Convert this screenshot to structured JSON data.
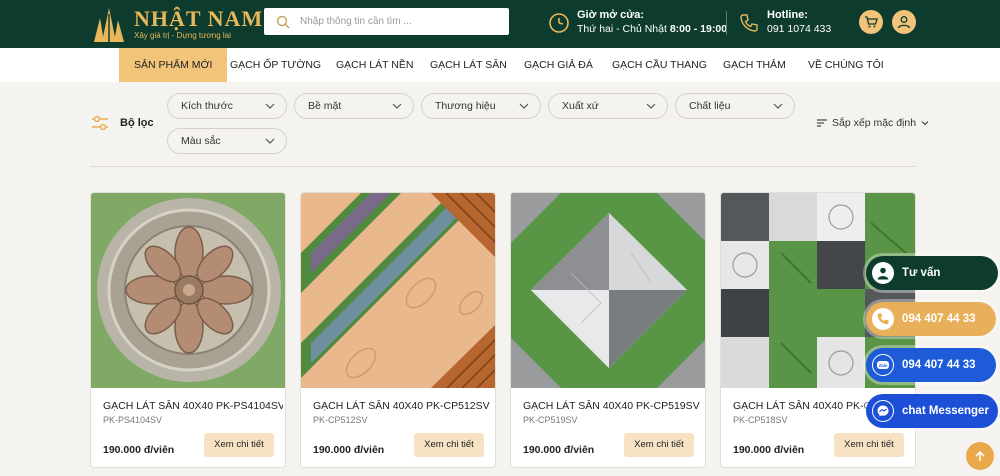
{
  "brand": {
    "name": "NHẬT NAM",
    "slogan": "Xây giá trị - Dựng tương lai"
  },
  "search": {
    "placeholder": "Nhập thông tin cần tìm ..."
  },
  "opening": {
    "title": "Giờ mở cửa:",
    "days": "Thứ hai - Chủ Nhật",
    "time": "8:00 - 19:00"
  },
  "hotline": {
    "title": "Hotline:",
    "number": "091 1074 433"
  },
  "header_icons": [
    "cart-icon",
    "user-icon"
  ],
  "nav": [
    "SẢN PHẨM MỚI",
    "GẠCH ỐP TƯỜNG",
    "GẠCH LÁT NỀN",
    "GẠCH LÁT SÂN",
    "GẠCH GIẢ ĐÁ",
    "GẠCH CẦU THANG",
    "GẠCH THẢM",
    "VỀ CHÚNG TÔI"
  ],
  "filters": {
    "label": "Bộ lọc",
    "dropdowns": [
      "Kích thước",
      "Bề mặt",
      "Thương hiệu",
      "Xuất xứ",
      "Chất liệu",
      "Màu sắc"
    ],
    "sort": "Sắp xếp mặc định"
  },
  "products": [
    {
      "name": "GẠCH LÁT SÂN 40X40 PK-PS4104SV",
      "code": "PK-PS4104SV",
      "price": "190.000 đ/viên",
      "button": "Xem chi tiết"
    },
    {
      "name": "GẠCH LÁT SÂN 40X40 PK-CP512SV",
      "code": "PK-CP512SV",
      "price": "190.000 đ/viên",
      "button": "Xem chi tiết"
    },
    {
      "name": "GẠCH LÁT SÂN 40X40 PK-CP519SV",
      "code": "PK-CP519SV",
      "price": "190.000 đ/viên",
      "button": "Xem chi tiết"
    },
    {
      "name": "GẠCH LÁT SÂN 40X40 PK-CP518SV",
      "code": "PK-CP518SV",
      "price": "190.000 đ/viên",
      "button": "Xem chi tiết"
    }
  ],
  "floating": {
    "consult": "Tư vấn",
    "phone": "094 407 44 33",
    "zalo": "094 407 44 33",
    "messenger": "chat Messenger"
  },
  "colors": {
    "header_bg": "#0d3b2e",
    "accent": "#f2c47a",
    "gold": "#e8b75a",
    "page_bg": "#f5f3ef"
  }
}
